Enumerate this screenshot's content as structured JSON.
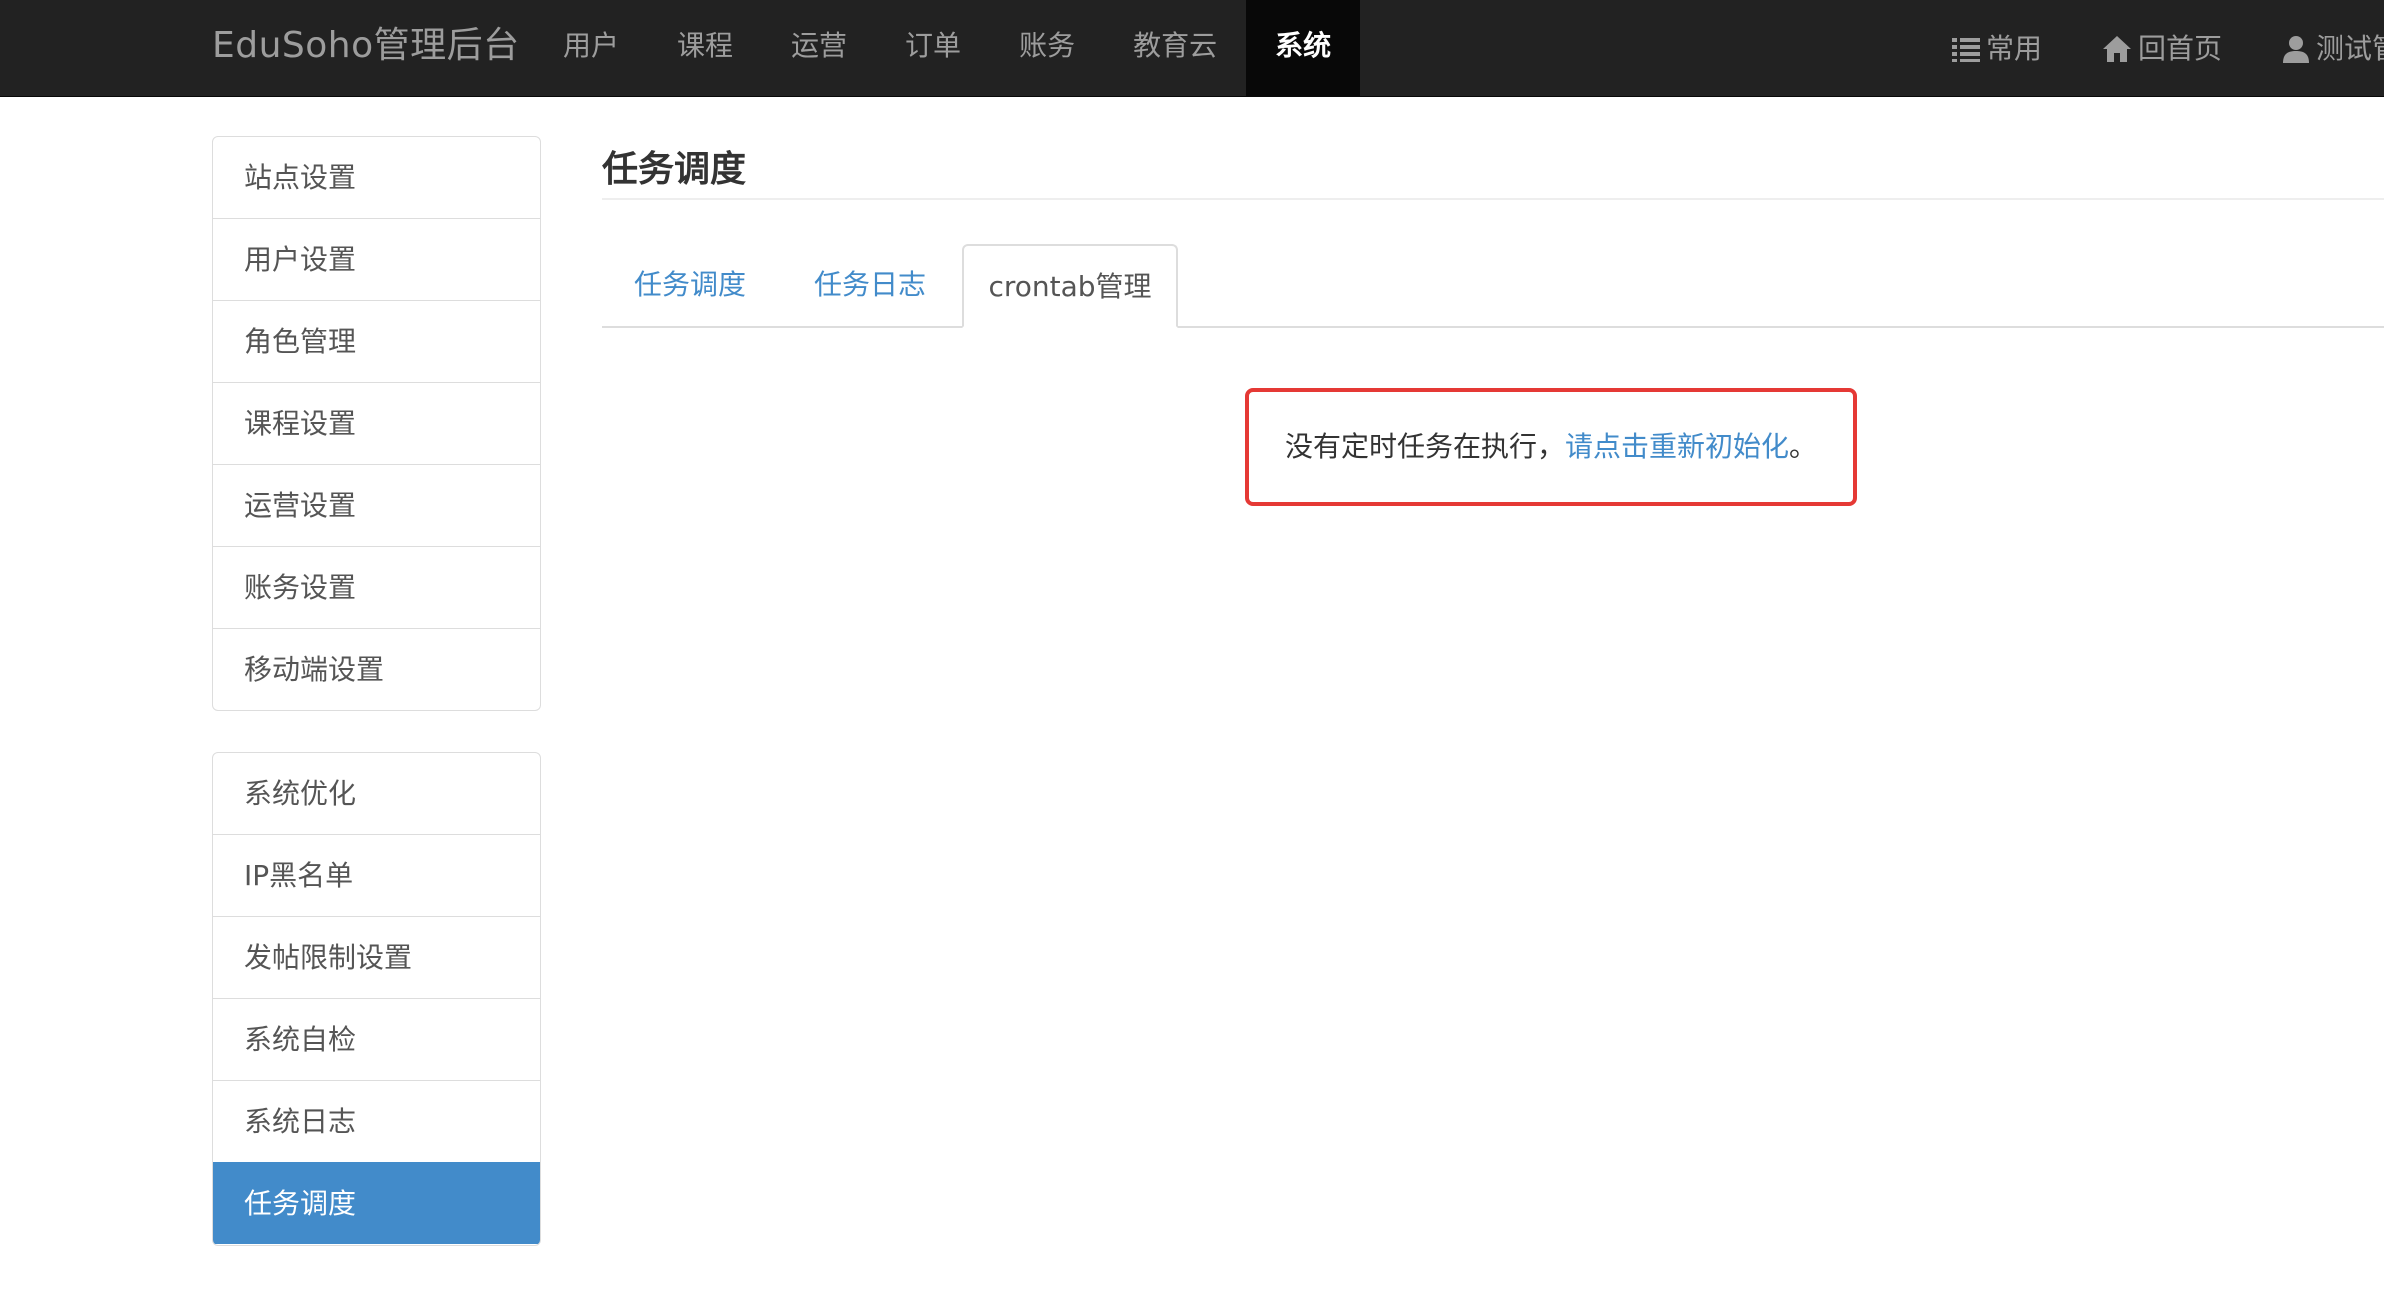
{
  "navbar": {
    "brand": "EduSoho管理后台",
    "items": [
      {
        "label": "用户",
        "active": false
      },
      {
        "label": "课程",
        "active": false
      },
      {
        "label": "运营",
        "active": false
      },
      {
        "label": "订单",
        "active": false
      },
      {
        "label": "账务",
        "active": false
      },
      {
        "label": "教育云",
        "active": false
      },
      {
        "label": "系统",
        "active": true
      }
    ],
    "right": {
      "common_label": "常用",
      "home_label": "回首页",
      "user_label": "测试管"
    }
  },
  "sidebar": {
    "group1": [
      "站点设置",
      "用户设置",
      "角色管理",
      "课程设置",
      "运营设置",
      "账务设置",
      "移动端设置"
    ],
    "group2": [
      "系统优化",
      "IP黑名单",
      "发帖限制设置",
      "系统自检",
      "系统日志",
      "任务调度"
    ],
    "active_item": "任务调度"
  },
  "main": {
    "title": "任务调度",
    "tabs": [
      "任务调度",
      "任务日志",
      "crontab管理"
    ],
    "active_tab": "crontab管理",
    "alert": {
      "text_before": "没有定时任务在执行，",
      "link": "请点击重新初始化",
      "text_after": "。"
    }
  },
  "colors": {
    "navbar_bg": "#222222",
    "nav_active_bg": "#080808",
    "link": "#428bca",
    "active_item_bg": "#428bca",
    "highlight_border": "#e53935"
  },
  "icons": [
    "list-icon",
    "home-icon",
    "user-icon"
  ]
}
